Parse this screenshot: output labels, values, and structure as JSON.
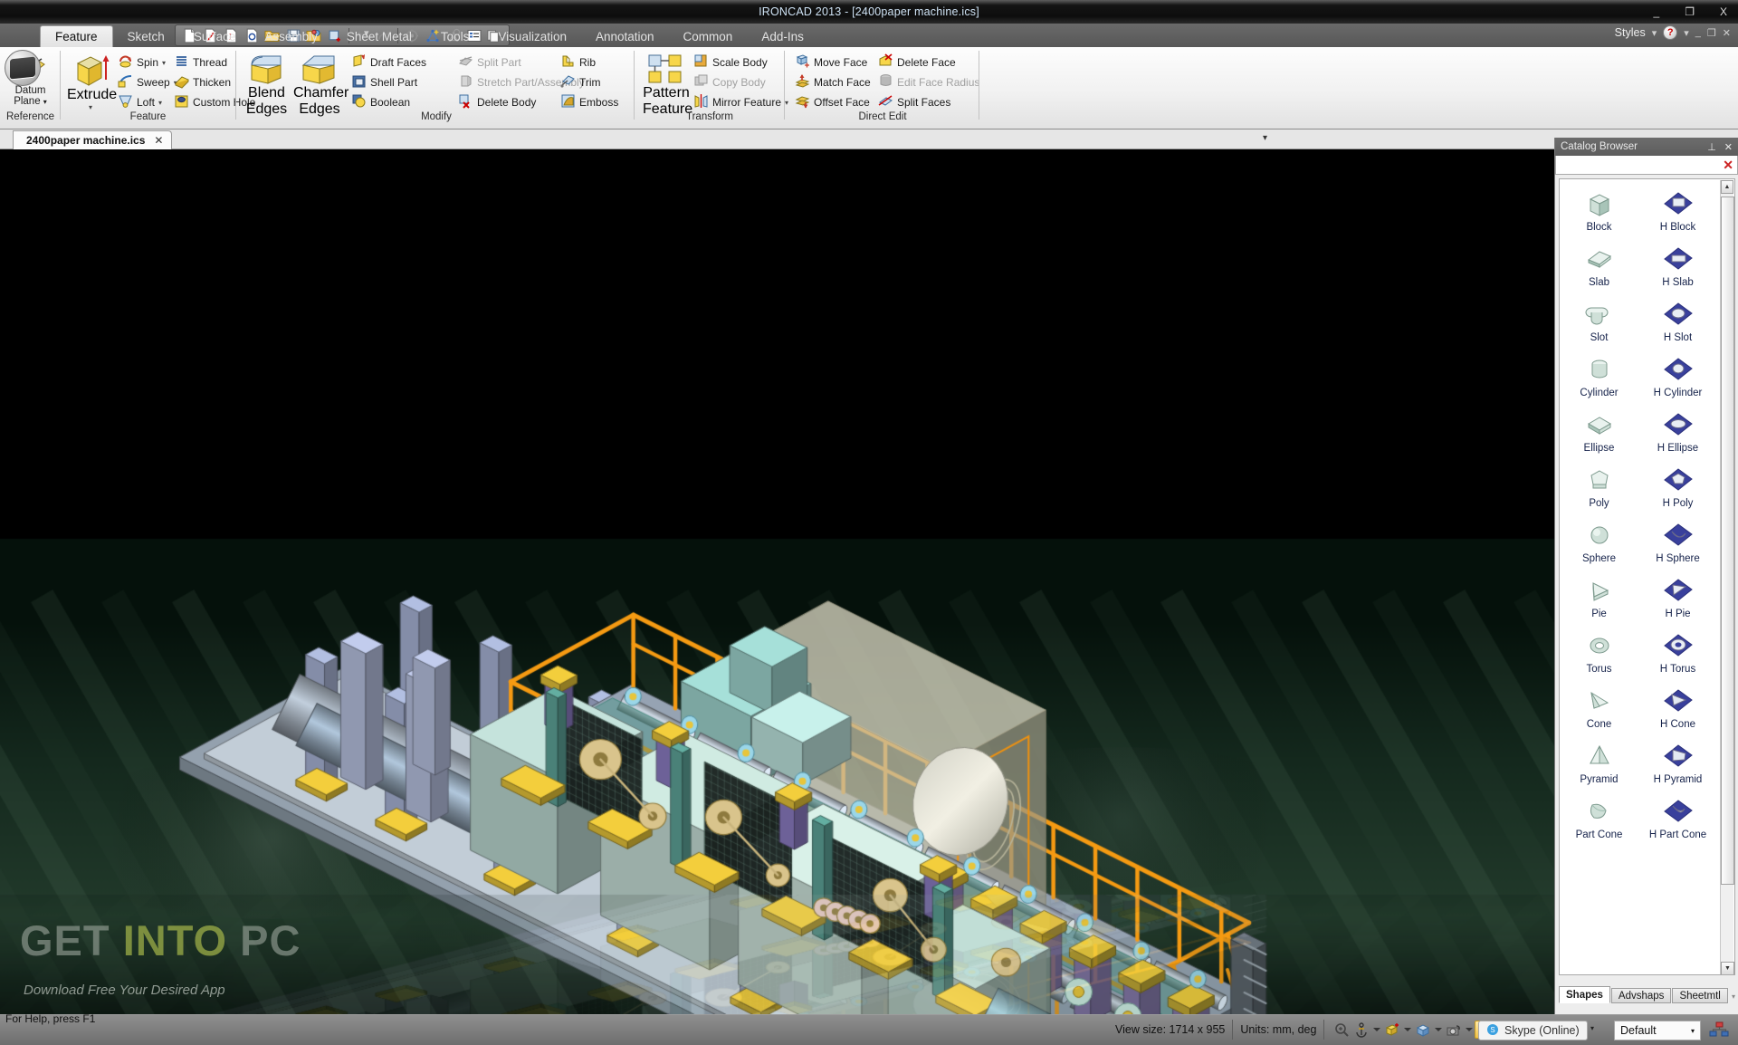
{
  "window": {
    "title": "IRONCAD 2013 - [2400paper machine.ics]",
    "minimize": "_",
    "maximize": "❐",
    "close": "X"
  },
  "quick_access": {
    "icons": [
      "new-icon",
      "new-drawing-icon",
      "new-sheet-icon",
      "new-preview-icon",
      "open-icon",
      "save-icon",
      "save-as-icon",
      "new-part-icon",
      "undo-icon",
      "redo-icon",
      "rotate-icon",
      "smart-snap-icon",
      "snap-icon",
      "properties-icon",
      "copies-icon"
    ],
    "dropdown": "▾",
    "customize": "▾"
  },
  "ribbon": {
    "tabs": [
      {
        "label": "Feature",
        "active": true
      },
      {
        "label": "Sketch",
        "active": false
      },
      {
        "label": "Surface",
        "active": false
      },
      {
        "label": "Assembly",
        "active": false
      },
      {
        "label": "Sheet Metal",
        "active": false
      },
      {
        "label": "Tools",
        "active": false
      },
      {
        "label": "Visualization",
        "active": false
      },
      {
        "label": "Annotation",
        "active": false
      },
      {
        "label": "Common",
        "active": false
      },
      {
        "label": "Add-Ins",
        "active": false
      }
    ],
    "styles_label": "Styles",
    "groups": {
      "reference": {
        "label": "Reference",
        "datum_plane": "Datum\nPlane"
      },
      "feature": {
        "label": "Feature",
        "extrude": "Extrude",
        "items": [
          {
            "label": "Spin",
            "icon": "spin-icon",
            "dropdown": true,
            "disabled": false
          },
          {
            "label": "Thread",
            "icon": "thread-icon",
            "dropdown": false,
            "disabled": false
          },
          {
            "label": "Sweep",
            "icon": "sweep-icon",
            "dropdown": true,
            "disabled": false
          },
          {
            "label": "Thicken",
            "icon": "thicken-icon",
            "dropdown": false,
            "disabled": false
          },
          {
            "label": "Loft",
            "icon": "loft-icon",
            "dropdown": true,
            "disabled": false
          },
          {
            "label": "Custom Hole",
            "icon": "custom-hole-icon",
            "dropdown": false,
            "disabled": false
          }
        ]
      },
      "modify": {
        "label": "Modify",
        "blend_edges": "Blend\nEdges",
        "chamfer_edges": "Chamfer\nEdges",
        "items": [
          {
            "label": "Draft Faces",
            "icon": "draft-faces-icon",
            "disabled": false
          },
          {
            "label": "Split Part",
            "icon": "split-part-icon",
            "disabled": true
          },
          {
            "label": "Rib",
            "icon": "rib-icon",
            "disabled": false
          },
          {
            "label": "Shell Part",
            "icon": "shell-part-icon",
            "disabled": false
          },
          {
            "label": "Stretch Part/Assembly",
            "icon": "stretch-part-icon",
            "disabled": true
          },
          {
            "label": "Trim",
            "icon": "trim-icon",
            "disabled": false
          },
          {
            "label": "Boolean",
            "icon": "boolean-icon",
            "disabled": false
          },
          {
            "label": "Delete Body",
            "icon": "delete-body-icon",
            "disabled": false
          },
          {
            "label": "Emboss",
            "icon": "emboss-icon",
            "disabled": false
          }
        ]
      },
      "transform": {
        "label": "Transform",
        "pattern_feature": "Pattern\nFeature",
        "items": [
          {
            "label": "Scale Body",
            "icon": "scale-body-icon",
            "disabled": false,
            "dropdown": false
          },
          {
            "label": "Copy Body",
            "icon": "copy-body-icon",
            "disabled": true,
            "dropdown": false
          },
          {
            "label": "Mirror Feature",
            "icon": "mirror-feature-icon",
            "disabled": false,
            "dropdown": true
          }
        ]
      },
      "direct_edit": {
        "label": "Direct Edit",
        "items": [
          {
            "label": "Move Face",
            "icon": "move-face-icon",
            "disabled": false
          },
          {
            "label": "Delete Face",
            "icon": "delete-face-icon",
            "disabled": false
          },
          {
            "label": "Match Face",
            "icon": "match-face-icon",
            "disabled": false
          },
          {
            "label": "Edit Face Radius",
            "icon": "edit-face-radius-icon",
            "disabled": true
          },
          {
            "label": "Offset Face",
            "icon": "offset-face-icon",
            "disabled": false
          },
          {
            "label": "Split Faces",
            "icon": "split-faces-icon",
            "disabled": false
          }
        ]
      }
    }
  },
  "document_tab": {
    "label": "2400paper machine.ics",
    "close": "✕",
    "dropdown": "▾"
  },
  "viewport": {
    "watermark_main_1": "GET ",
    "watermark_main_2": "INTO",
    "watermark_main_3": " PC",
    "watermark_sub": "Download Free Your Desired App",
    "background": "#000000"
  },
  "catalog": {
    "title": "Catalog Browser",
    "pin": "⊥",
    "close": "✕",
    "toolbar_close": "✕",
    "items": [
      {
        "label": "Block",
        "icon": "block-shape-icon",
        "hole": false
      },
      {
        "label": "H Block",
        "icon": "h-block-shape-icon",
        "hole": true
      },
      {
        "label": "Slab",
        "icon": "slab-shape-icon",
        "hole": false
      },
      {
        "label": "H Slab",
        "icon": "h-slab-shape-icon",
        "hole": true
      },
      {
        "label": "Slot",
        "icon": "slot-shape-icon",
        "hole": false
      },
      {
        "label": "H Slot",
        "icon": "h-slot-shape-icon",
        "hole": true
      },
      {
        "label": "Cylinder",
        "icon": "cylinder-shape-icon",
        "hole": false
      },
      {
        "label": "H Cylinder",
        "icon": "h-cylinder-shape-icon",
        "hole": true
      },
      {
        "label": "Ellipse",
        "icon": "ellipse-shape-icon",
        "hole": false
      },
      {
        "label": "H Ellipse",
        "icon": "h-ellipse-shape-icon",
        "hole": true
      },
      {
        "label": "Poly",
        "icon": "poly-shape-icon",
        "hole": false
      },
      {
        "label": "H Poly",
        "icon": "h-poly-shape-icon",
        "hole": true
      },
      {
        "label": "Sphere",
        "icon": "sphere-shape-icon",
        "hole": false
      },
      {
        "label": "H Sphere",
        "icon": "h-sphere-shape-icon",
        "hole": true
      },
      {
        "label": "Pie",
        "icon": "pie-shape-icon",
        "hole": false
      },
      {
        "label": "H Pie",
        "icon": "h-pie-shape-icon",
        "hole": true
      },
      {
        "label": "Torus",
        "icon": "torus-shape-icon",
        "hole": false
      },
      {
        "label": "H Torus",
        "icon": "h-torus-shape-icon",
        "hole": true
      },
      {
        "label": "Cone",
        "icon": "cone-shape-icon",
        "hole": false
      },
      {
        "label": "H Cone",
        "icon": "h-cone-shape-icon",
        "hole": true
      },
      {
        "label": "Pyramid",
        "icon": "pyramid-shape-icon",
        "hole": false
      },
      {
        "label": "H Pyramid",
        "icon": "h-pyramid-shape-icon",
        "hole": true
      },
      {
        "label": "Part Cone",
        "icon": "part-cone-shape-icon",
        "hole": false
      },
      {
        "label": "H Part Cone",
        "icon": "h-part-cone-shape-icon",
        "hole": true
      }
    ],
    "tabs": [
      {
        "label": "Shapes",
        "selected": true
      },
      {
        "label": "Advshaps",
        "selected": false
      },
      {
        "label": "Sheetmtl",
        "selected": false
      }
    ],
    "tab_overflow": "▾"
  },
  "status_bar": {
    "help_text": "For Help, press F1",
    "view_size": "View size: 1714 x  955",
    "units": "Units: mm, deg",
    "icons": [
      "zoom-icon",
      "anchor-icon",
      "render-mode-icon",
      "shaded-cube-icon",
      "camera-icon",
      "shaded-view-icon",
      "wireframe-view-icon"
    ],
    "skype": "Skype (Online)",
    "scene_style": "Default",
    "network_icon": "network-icon"
  }
}
